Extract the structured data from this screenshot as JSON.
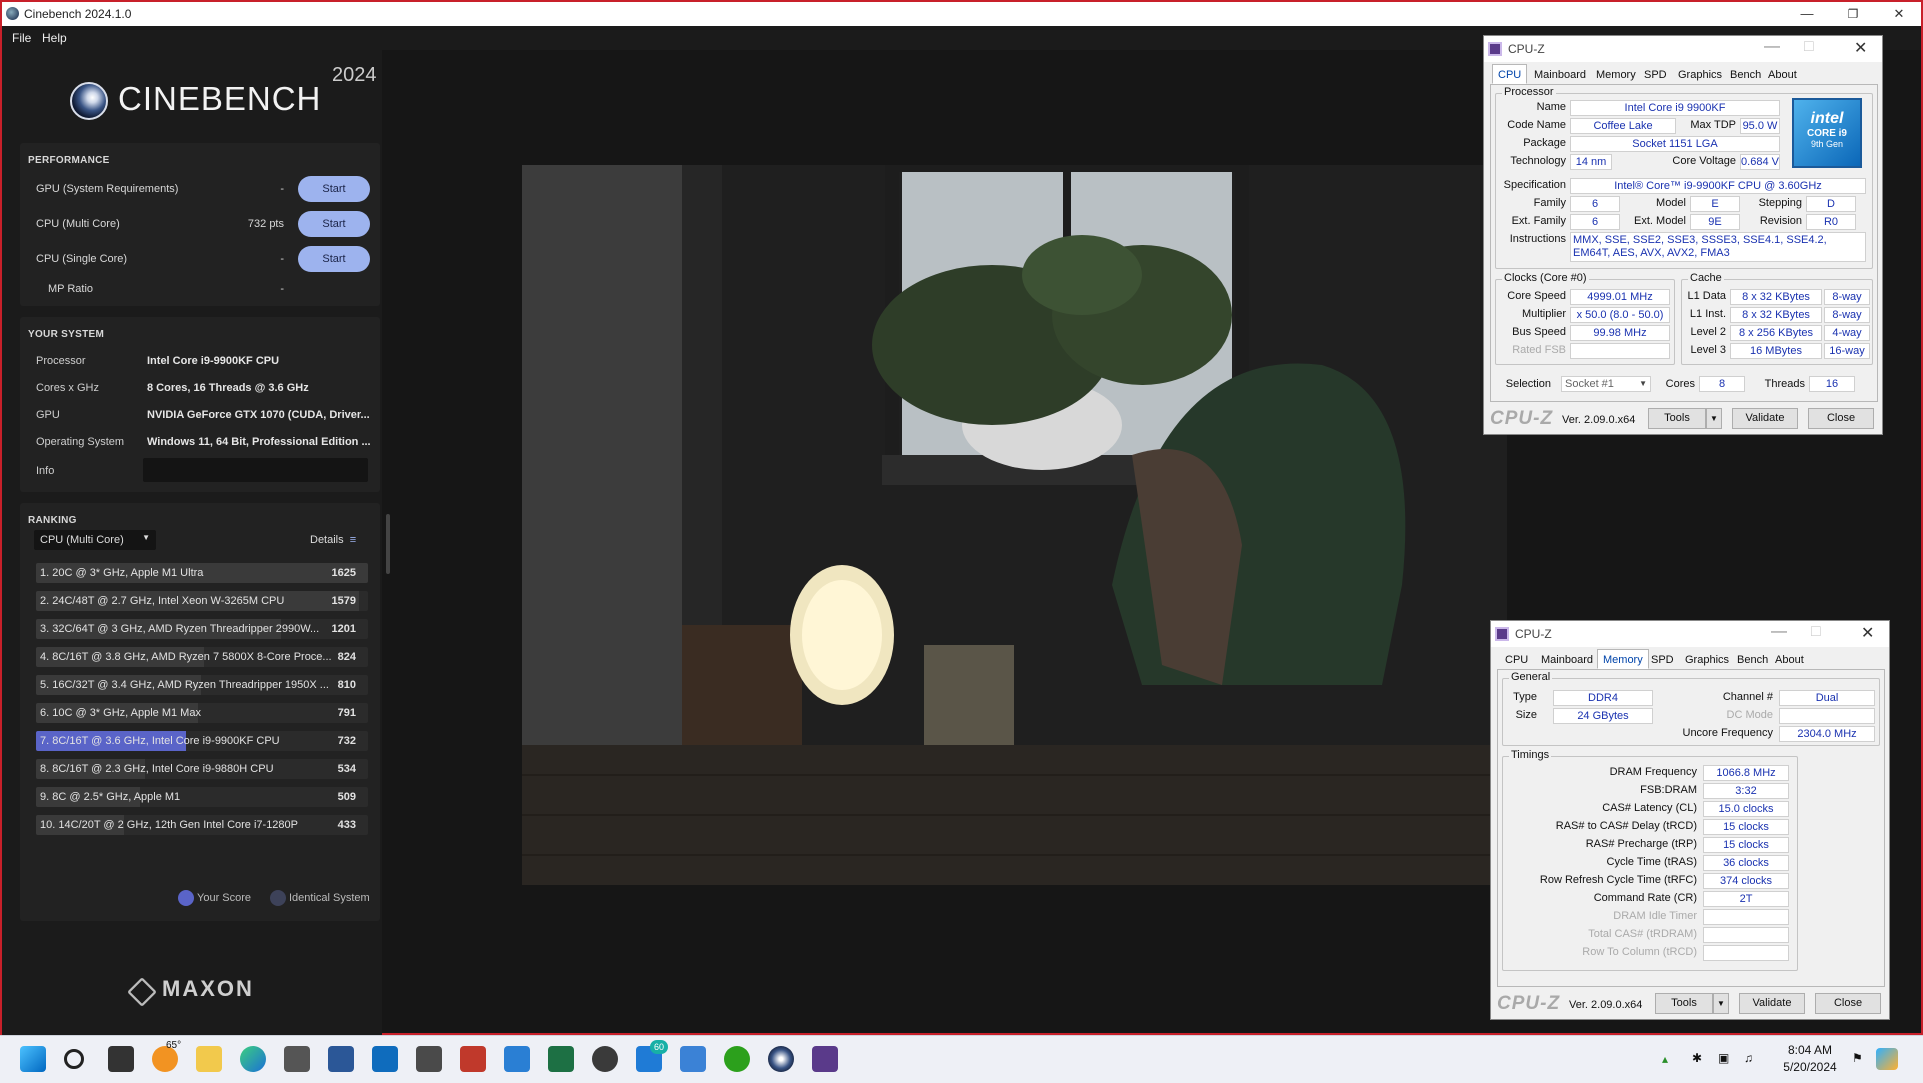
{
  "cinebench": {
    "window_title": "Cinebench 2024.1.0",
    "menu": [
      "File",
      "Help"
    ],
    "brand": "CINEBENCH",
    "year": "2024",
    "performance": {
      "header": "PERFORMANCE",
      "rows": [
        {
          "label": "GPU (System Requirements)",
          "value": "-",
          "button": "Start"
        },
        {
          "label": "CPU (Multi Core)",
          "value": "732 pts",
          "button": "Start"
        },
        {
          "label": "CPU (Single Core)",
          "value": "-",
          "button": "Start"
        },
        {
          "label": "MP Ratio",
          "value": "-"
        }
      ]
    },
    "system": {
      "header": "YOUR SYSTEM",
      "rows": [
        {
          "label": "Processor",
          "value": "Intel Core i9-9900KF CPU"
        },
        {
          "label": "Cores x GHz",
          "value": "8 Cores, 16 Threads @ 3.6 GHz"
        },
        {
          "label": "GPU",
          "value": "NVIDIA GeForce GTX 1070 (CUDA, Driver..."
        },
        {
          "label": "Operating System",
          "value": "Windows 11, 64 Bit, Professional Edition ..."
        },
        {
          "label": "Info",
          "value": ""
        }
      ]
    },
    "ranking": {
      "header": "RANKING",
      "dropdown": "CPU (Multi Core)",
      "details": "Details",
      "items": [
        {
          "label": "1. 20C @ 3* GHz, Apple M1 Ultra",
          "score": 1625
        },
        {
          "label": "2. 24C/48T @ 2.7 GHz, Intel Xeon W-3265M CPU",
          "score": 1579
        },
        {
          "label": "3. 32C/64T @ 3 GHz, AMD Ryzen Threadripper 2990W...",
          "score": 1201
        },
        {
          "label": "4. 8C/16T @ 3.8 GHz, AMD Ryzen 7 5800X 8-Core Proce...",
          "score": 824
        },
        {
          "label": "5. 16C/32T @ 3.4 GHz, AMD Ryzen Threadripper 1950X ...",
          "score": 810
        },
        {
          "label": "6. 10C @ 3* GHz, Apple M1 Max",
          "score": 791
        },
        {
          "label": "7. 8C/16T @ 3.6 GHz, Intel Core i9-9900KF CPU",
          "score": 732,
          "mine": true
        },
        {
          "label": "8. 8C/16T @ 2.3 GHz, Intel Core i9-9880H CPU",
          "score": 534
        },
        {
          "label": "9. 8C @ 2.5* GHz, Apple M1",
          "score": 509
        },
        {
          "label": "10. 14C/20T @ 2 GHz, 12th Gen Intel Core i7-1280P",
          "score": 433
        }
      ],
      "legend": {
        "your_score": "Your Score",
        "identical": "Identical System"
      },
      "colors": {
        "your_score": "#5a64c8",
        "identical": "#3d4259"
      }
    },
    "maxon": "MAXON"
  },
  "cpuz_cpu": {
    "title": "CPU-Z",
    "tabs": [
      "CPU",
      "Mainboard",
      "Memory",
      "SPD",
      "Graphics",
      "Bench",
      "About"
    ],
    "active_tab": "CPU",
    "processor_group": "Processor",
    "name_label": "Name",
    "name": "Intel Core i9 9900KF",
    "codename_label": "Code Name",
    "codename": "Coffee Lake",
    "maxtdp_label": "Max TDP",
    "maxtdp": "95.0 W",
    "package_label": "Package",
    "package": "Socket 1151 LGA",
    "technology_label": "Technology",
    "technology": "14 nm",
    "corevoltage_label": "Core Voltage",
    "corevoltage": "0.684 V",
    "spec_label": "Specification",
    "spec": "Intel® Core™ i9-9900KF CPU @ 3.60GHz",
    "family_label": "Family",
    "family": "6",
    "model_label": "Model",
    "model": "E",
    "stepping_label": "Stepping",
    "stepping": "D",
    "extfamily_label": "Ext. Family",
    "extfamily": "6",
    "extmodel_label": "Ext. Model",
    "extmodel": "9E",
    "revision_label": "Revision",
    "revision": "R0",
    "instructions_label": "Instructions",
    "instructions": "MMX, SSE, SSE2, SSE3, SSSE3, SSE4.1, SSE4.2, EM64T, AES, AVX, AVX2, FMA3",
    "intel_badge": {
      "brand": "intel",
      "line1": "CORE i9",
      "line2": "9th Gen"
    },
    "clocks_group": "Clocks (Core #0)",
    "corespeed_label": "Core Speed",
    "corespeed": "4999.01 MHz",
    "multiplier_label": "Multiplier",
    "multiplier": "x 50.0 (8.0 - 50.0)",
    "busspeed_label": "Bus Speed",
    "busspeed": "99.98 MHz",
    "ratedfsb_label": "Rated FSB",
    "cache_group": "Cache",
    "cache": [
      {
        "label": "L1 Data",
        "size": "8 x 32 KBytes",
        "way": "8-way"
      },
      {
        "label": "L1 Inst.",
        "size": "8 x 32 KBytes",
        "way": "8-way"
      },
      {
        "label": "Level 2",
        "size": "8 x 256 KBytes",
        "way": "4-way"
      },
      {
        "label": "Level 3",
        "size": "16 MBytes",
        "way": "16-way"
      }
    ],
    "selection_label": "Selection",
    "selection": "Socket #1",
    "cores_label": "Cores",
    "cores": "8",
    "threads_label": "Threads",
    "threads": "16",
    "logo": "CPU-Z",
    "version": "Ver. 2.09.0.x64",
    "tools": "Tools",
    "validate": "Validate",
    "close": "Close"
  },
  "cpuz_mem": {
    "title": "CPU-Z",
    "tabs": [
      "CPU",
      "Mainboard",
      "Memory",
      "SPD",
      "Graphics",
      "Bench",
      "About"
    ],
    "active_tab": "Memory",
    "general_group": "General",
    "type_label": "Type",
    "type": "DDR4",
    "size_label": "Size",
    "size": "24 GBytes",
    "channel_label": "Channel #",
    "channel": "Dual",
    "dcmode_label": "DC Mode",
    "uncore_label": "Uncore Frequency",
    "uncore": "2304.0 MHz",
    "timings_group": "Timings",
    "timings": [
      {
        "label": "DRAM Frequency",
        "value": "1066.8 MHz"
      },
      {
        "label": "FSB:DRAM",
        "value": "3:32"
      },
      {
        "label": "CAS# Latency (CL)",
        "value": "15.0 clocks"
      },
      {
        "label": "RAS# to CAS# Delay (tRCD)",
        "value": "15 clocks"
      },
      {
        "label": "RAS# Precharge (tRP)",
        "value": "15 clocks"
      },
      {
        "label": "Cycle Time (tRAS)",
        "value": "36 clocks"
      },
      {
        "label": "Row Refresh Cycle Time (tRFC)",
        "value": "374 clocks"
      },
      {
        "label": "Command Rate (CR)",
        "value": "2T"
      },
      {
        "label": "DRAM Idle Timer",
        "value": ""
      },
      {
        "label": "Total CAS# (tRDRAM)",
        "value": ""
      },
      {
        "label": "Row To Column (tRCD)",
        "value": ""
      }
    ],
    "logo": "CPU-Z",
    "version": "Ver. 2.09.0.x64",
    "tools": "Tools",
    "validate": "Validate",
    "close": "Close"
  },
  "taskbar": {
    "weather_temp": "65°",
    "badge_count": "60",
    "time": "8:04 AM",
    "date": "5/20/2024",
    "icons": [
      "start-icon",
      "search-icon",
      "task-view-icon",
      "weather-icon",
      "file-explorer-icon",
      "edge-icon",
      "store-icon",
      "word-icon",
      "outlook-icon",
      "calculator-icon",
      "snipping-tool-icon",
      "3d-icon",
      "excel-icon",
      "clock-icon",
      "teams-icon",
      "notepad-icon",
      "quickbooks-icon",
      "cinebench-icon",
      "cpuz-icon"
    ]
  }
}
